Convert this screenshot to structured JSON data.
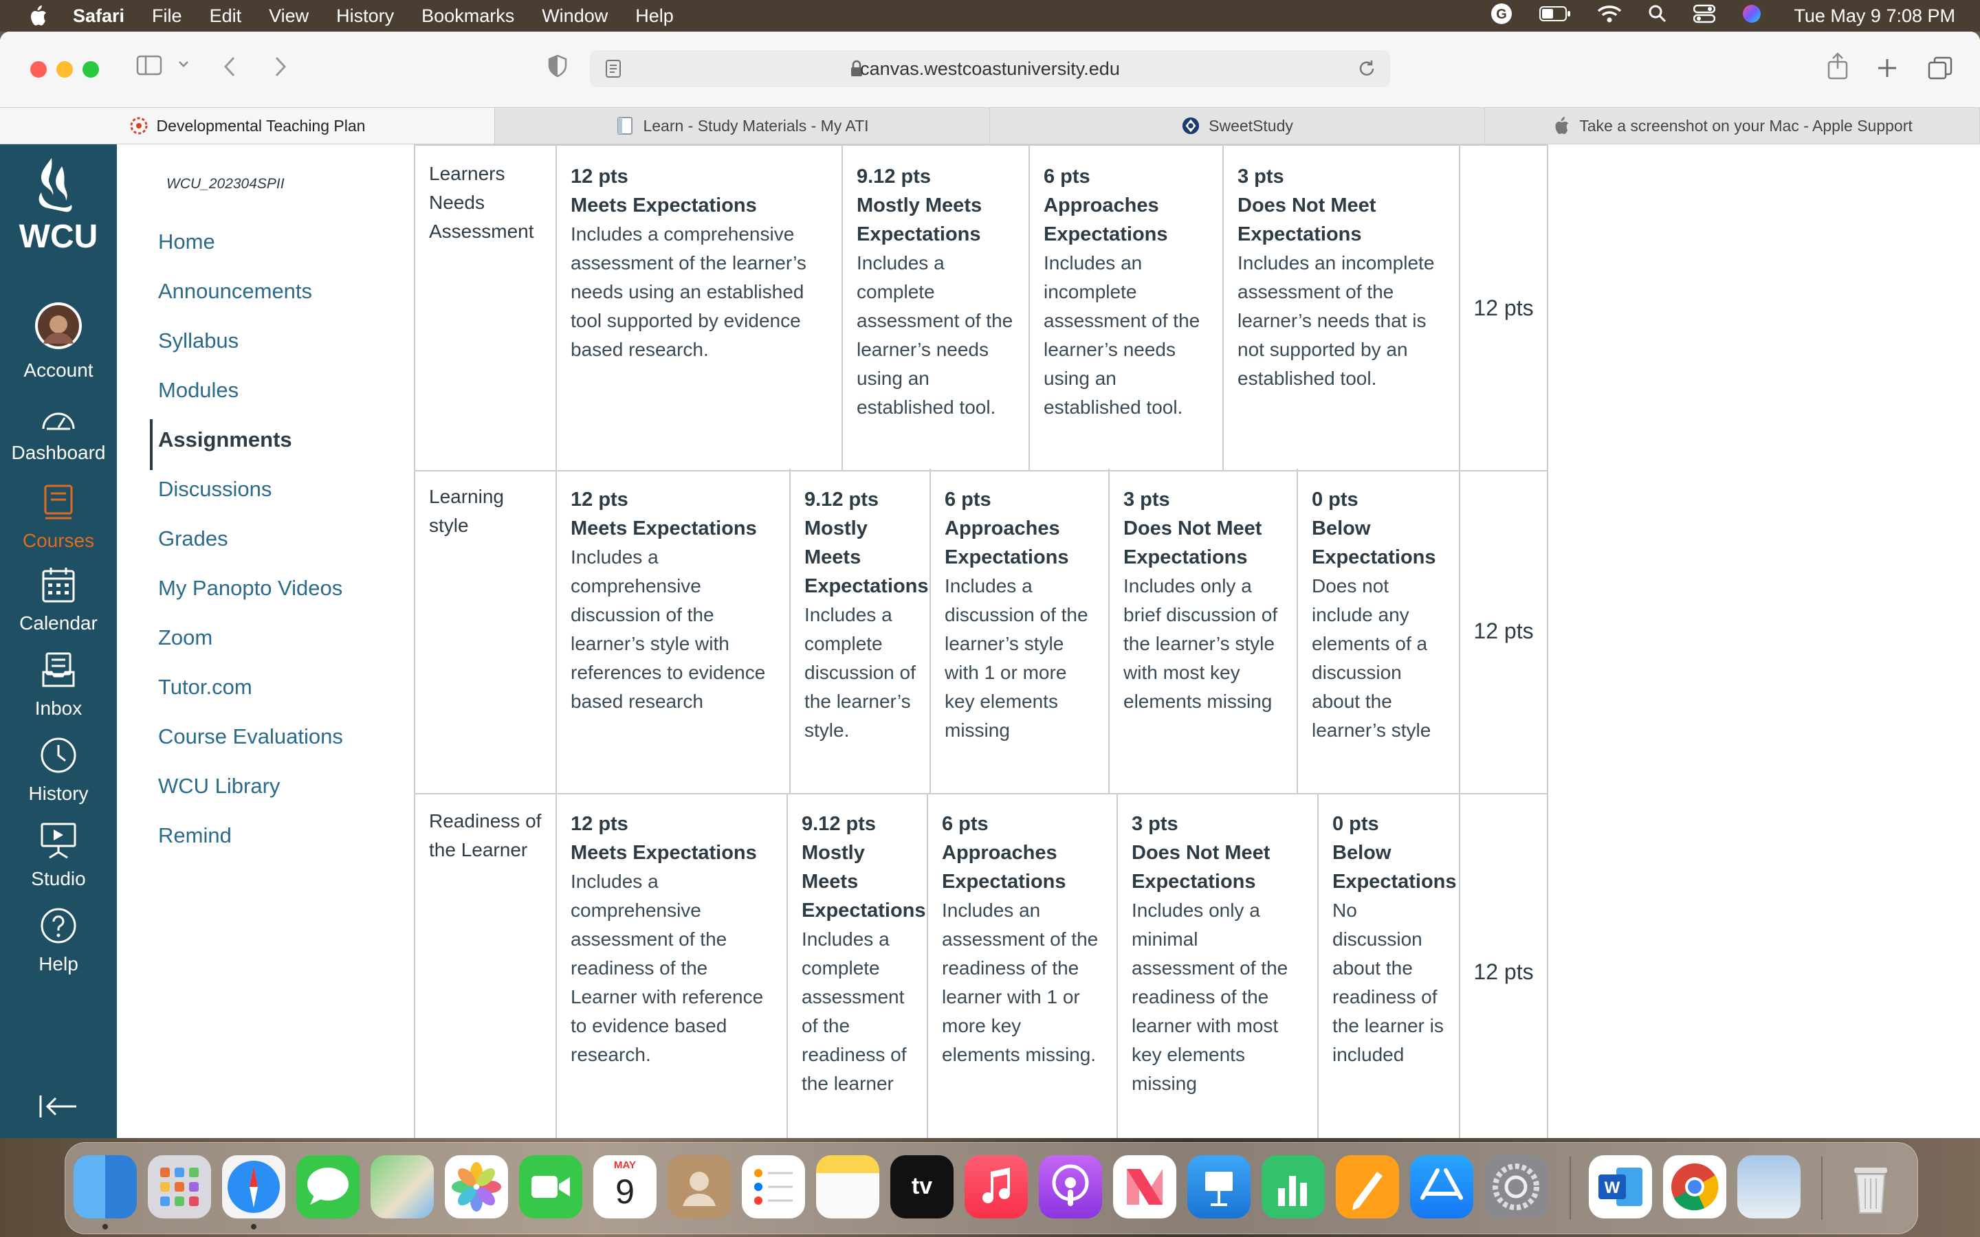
{
  "menubar": {
    "app_name": "Safari",
    "items": [
      "File",
      "Edit",
      "View",
      "History",
      "Bookmarks",
      "Window",
      "Help"
    ],
    "datetime": "Tue May 9  7:08 PM"
  },
  "browser": {
    "url": "canvas.westcoastuniversity.edu",
    "tabs": [
      {
        "label": "Developmental Teaching Plan",
        "icon": "canvas-icon"
      },
      {
        "label": "Learn - Study Materials - My ATI",
        "icon": "document-icon"
      },
      {
        "label": "SweetStudy",
        "icon": "sweetstudy-icon"
      },
      {
        "label": "Take a screenshot on your Mac - Apple Support",
        "icon": "apple-icon"
      }
    ]
  },
  "global_nav": {
    "logo_text": "WCU",
    "items": [
      {
        "label": "Account",
        "icon": "avatar"
      },
      {
        "label": "Dashboard",
        "icon": "dashboard-icon"
      },
      {
        "label": "Courses",
        "icon": "courses-icon",
        "active": true
      },
      {
        "label": "Calendar",
        "icon": "calendar-icon"
      },
      {
        "label": "Inbox",
        "icon": "inbox-icon"
      },
      {
        "label": "History",
        "icon": "history-icon"
      },
      {
        "label": "Studio",
        "icon": "studio-icon"
      },
      {
        "label": "Help",
        "icon": "help-icon"
      }
    ],
    "accent_color": "#e06c22",
    "bg_color": "#1f4f62"
  },
  "course_nav": {
    "course_code": "WCU_202304SPII",
    "links": [
      {
        "label": "Home"
      },
      {
        "label": "Announcements"
      },
      {
        "label": "Syllabus"
      },
      {
        "label": "Modules"
      },
      {
        "label": "Assignments",
        "active": true
      },
      {
        "label": "Discussions"
      },
      {
        "label": "Grades"
      },
      {
        "label": "My Panopto Videos"
      },
      {
        "label": "Zoom"
      },
      {
        "label": "Tutor.com"
      },
      {
        "label": "Course Evaluations"
      },
      {
        "label": "WCU Library"
      },
      {
        "label": "Remind"
      }
    ]
  },
  "rubric": {
    "rows": [
      {
        "criterion": "Learners Needs Assessment",
        "total": "12 pts",
        "ratings": [
          {
            "pts": "12 pts",
            "title": "Meets Expectations",
            "desc": "Includes a comprehensive assessment of the learner’s needs using an established tool supported by evidence based research."
          },
          {
            "pts": "9.12 pts",
            "title": "Mostly Meets Expectations",
            "desc": "Includes a complete assessment of the learner’s needs using an established tool."
          },
          {
            "pts": "6 pts",
            "title": "Approaches Expectations",
            "desc": "Includes an incomplete assessment of the learner’s needs using an established tool."
          },
          {
            "pts": "3 pts",
            "title": "Does Not Meet Expectations",
            "desc": "Includes an incomplete assessment of the learner’s needs that is not supported by an established tool."
          }
        ]
      },
      {
        "criterion": "Learning style",
        "total": "12 pts",
        "ratings": [
          {
            "pts": "12 pts",
            "title": "Meets Expectations",
            "desc": "Includes a comprehensive discussion of the learner’s style with references to evidence based research"
          },
          {
            "pts": "9.12 pts",
            "title": "Mostly Meets Expectations",
            "desc": "Includes a complete discussion of the learner’s style."
          },
          {
            "pts": "6 pts",
            "title": "Approaches Expectations",
            "desc": "Includes a discussion of the learner’s style with 1 or more key elements missing"
          },
          {
            "pts": "3 pts",
            "title": "Does Not Meet Expectations",
            "desc": "Includes only a brief discussion of the learner’s style with most key elements missing"
          },
          {
            "pts": "0 pts",
            "title": "Below Expectations",
            "desc": "Does not include any elements of a discussion about the learner’s style"
          }
        ]
      },
      {
        "criterion": "Readiness of the Learner",
        "total": "12 pts",
        "ratings": [
          {
            "pts": "12 pts",
            "title": "Meets Expectations",
            "desc": "Includes a comprehensive assessment of the readiness of the Learner with reference to evidence based research."
          },
          {
            "pts": "9.12 pts",
            "title": "Mostly Meets Expectations",
            "desc": "Includes a complete assessment of the readiness of the learner"
          },
          {
            "pts": "6 pts",
            "title": "Approaches Expectations",
            "desc": "Includes an assessment of the readiness of the learner with 1 or more key elements missing."
          },
          {
            "pts": "3 pts",
            "title": "Does Not Meet Expectations",
            "desc": "Includes only a minimal assessment of the readiness of the learner with most key elements missing"
          },
          {
            "pts": "0 pts",
            "title": "Below Expectations",
            "desc": "No discussion about the readiness of the learner is included"
          }
        ]
      }
    ]
  },
  "dock": {
    "apps": [
      "Finder",
      "Launchpad",
      "Safari",
      "Messages",
      "Maps",
      "Photos",
      "FaceTime",
      "Calendar",
      "Contacts",
      "Reminders",
      "Notes",
      "TV",
      "Music",
      "Podcasts",
      "News",
      "Keynote",
      "Numbers",
      "Pages",
      "App Store",
      "System Settings",
      "Word",
      "Chrome",
      "Preview",
      "Trash"
    ],
    "calendar_month": "MAY",
    "calendar_day": "9",
    "tv_label": "tv"
  }
}
